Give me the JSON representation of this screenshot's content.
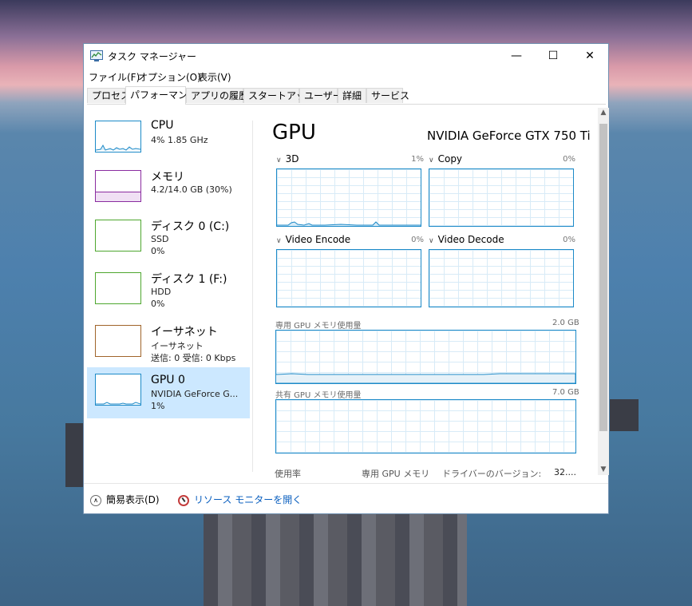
{
  "window": {
    "title": "タスク マネージャー",
    "controls": {
      "minimize": "—",
      "maximize": "☐",
      "close": "✕"
    }
  },
  "menu": [
    {
      "label": "ファイル(F)"
    },
    {
      "label": "オプション(O)"
    },
    {
      "label": "表示(V)"
    }
  ],
  "tabs": [
    {
      "label": "プロセス"
    },
    {
      "label": "パフォーマンス",
      "active": true
    },
    {
      "label": "アプリの履歴"
    },
    {
      "label": "スタートアップ"
    },
    {
      "label": "ユーザー"
    },
    {
      "label": "詳細"
    },
    {
      "label": "サービス"
    }
  ],
  "sidebar": [
    {
      "name": "CPU",
      "line1": "4%  1.85 GHz",
      "line2": "",
      "color": "#1c8ac8"
    },
    {
      "name": "メモリ",
      "line1": "4.2/14.0 GB (30%)",
      "line2": "",
      "color": "#8a2ca0"
    },
    {
      "name": "ディスク 0 (C:)",
      "line1": "SSD",
      "line2": "0%",
      "color": "#4ea72e"
    },
    {
      "name": "ディスク 1 (F:)",
      "line1": "HDD",
      "line2": "0%",
      "color": "#4ea72e"
    },
    {
      "name": "イーサネット",
      "line1": "イーサネット",
      "line2": "送信: 0 受信: 0 Kbps",
      "color": "#a0642a"
    },
    {
      "name": "GPU 0",
      "line1": "NVIDIA GeForce G...",
      "line2": "1%",
      "color": "#1c8ac8",
      "selected": true
    }
  ],
  "main": {
    "title": "GPU",
    "gpu_name": "NVIDIA GeForce GTX 750 Ti",
    "engines": [
      {
        "label": "3D",
        "percent": "1%"
      },
      {
        "label": "Copy",
        "percent": "0%"
      },
      {
        "label": "Video Encode",
        "percent": "0%"
      },
      {
        "label": "Video Decode",
        "percent": "0%"
      }
    ],
    "dedicated_mem": {
      "label": "専用 GPU メモリ使用量",
      "max": "2.0 GB"
    },
    "shared_mem": {
      "label": "共有 GPU メモリ使用量",
      "max": "7.0 GB"
    },
    "stats": {
      "usage_label": "使用率",
      "dedicated_label": "専用 GPU メモリ",
      "driver_label": "ドライバーのバージョン:",
      "driver_value": "32...."
    }
  },
  "footer": {
    "simple_view": "簡易表示(D)",
    "resource_monitor": "リソース モニターを開く"
  },
  "colors": {
    "accent_blue": "#1c8ac8",
    "memory_purple": "#8a2ca0",
    "disk_green": "#4ea72e",
    "ethernet_brown": "#a0642a",
    "selected_bg": "#cce8ff",
    "link": "#0a5fbf"
  }
}
